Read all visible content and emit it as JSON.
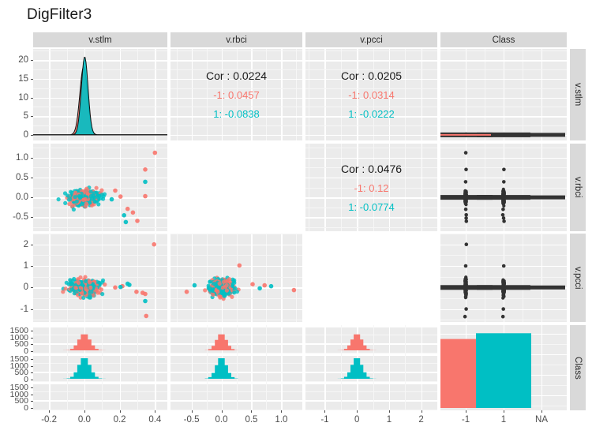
{
  "title": "DigFilter3",
  "colors": {
    "class_neg": "#F8766D",
    "class_pos": "#00BFC4",
    "panel_bg": "#EBEBEB",
    "strip_bg": "#D9D9D9",
    "grid": "#FFFFFF",
    "text": "#4D4D4D"
  },
  "variables": [
    "v.stlm",
    "v.rbci",
    "v.pcci",
    "Class"
  ],
  "column_strips": [
    "v.stlm",
    "v.rbci",
    "v.pcci",
    "Class"
  ],
  "row_strips": [
    "v.stlm",
    "v.rbci",
    "v.pcci",
    "Class"
  ],
  "axes": {
    "x": [
      {
        "var": "v.stlm",
        "ticks": [
          "-0.2",
          "0.0",
          "0.2",
          "0.4"
        ],
        "values": [
          -0.2,
          0.0,
          0.2,
          0.4
        ],
        "range": [
          -0.29,
          0.47
        ]
      },
      {
        "var": "v.rbci",
        "ticks": [
          "-0.5",
          "0.0",
          "0.5",
          "1.0"
        ],
        "values": [
          -0.5,
          0.0,
          0.5,
          1.0
        ],
        "range": [
          -0.85,
          1.35
        ]
      },
      {
        "var": "v.pcci",
        "ticks": [
          "-1",
          "0",
          "1",
          "2"
        ],
        "values": [
          -1,
          0,
          1,
          2
        ],
        "range": [
          -1.6,
          2.5
        ]
      },
      {
        "var": "Class",
        "ticks": [
          "-1",
          "1",
          "NA"
        ],
        "values": [
          "-1",
          "1",
          "NA"
        ],
        "range": null
      }
    ],
    "y": [
      {
        "var": "v.stlm",
        "ticks": [
          "0",
          "5",
          "10",
          "15",
          "20"
        ],
        "values": [
          0,
          5,
          10,
          15,
          20
        ],
        "range": [
          -1.5,
          23
        ]
      },
      {
        "var": "v.rbci",
        "ticks": [
          "-0.5",
          "0.0",
          "0.5",
          "1.0"
        ],
        "values": [
          -0.5,
          0.0,
          0.5,
          1.0
        ],
        "range": [
          -0.85,
          1.35
        ]
      },
      {
        "var": "v.pcci",
        "ticks": [
          "-1",
          "0",
          "1",
          "2"
        ],
        "values": [
          -1,
          0,
          1,
          2
        ],
        "range": [
          -1.6,
          2.5
        ]
      },
      {
        "var": "Class",
        "ticks": [
          "0",
          "500",
          "1000",
          "1500"
        ],
        "values": [
          0,
          500,
          1000,
          1500
        ],
        "range": [
          0,
          1750
        ],
        "facets": [
          "-1",
          "1",
          "NA"
        ]
      }
    ]
  },
  "correlations": [
    {
      "row": "v.stlm",
      "col": "v.rbci",
      "overall_label": "Cor : 0.0224",
      "overall": 0.0224,
      "neg_label": "-1: 0.0457",
      "neg": 0.0457,
      "pos_label": "1: -0.0838",
      "pos": -0.0838
    },
    {
      "row": "v.stlm",
      "col": "v.pcci",
      "overall_label": "Cor : 0.0205",
      "overall": 0.0205,
      "neg_label": "-1: 0.0314",
      "neg": 0.0314,
      "pos_label": "1: -0.0222",
      "pos": -0.0222
    },
    {
      "row": "v.rbci",
      "col": "v.pcci",
      "overall_label": "Cor : 0.0476",
      "overall": 0.0476,
      "neg_label": "-1: 0.12",
      "neg": 0.12,
      "pos_label": "1: -0.0774",
      "pos": -0.0774
    }
  ],
  "class_counts": {
    "categories": [
      "-1",
      "1",
      "NA"
    ],
    "values": [
      1500,
      1625,
      0
    ]
  },
  "chart_data": {
    "type": "scatter",
    "title": "DigFilter3",
    "plot_kind": "pairs-matrix",
    "variables": [
      "v.stlm",
      "v.rbci",
      "v.pcci",
      "Class"
    ],
    "groups": [
      {
        "name": "-1",
        "color": "#F8766D",
        "count": 1500
      },
      {
        "name": "1",
        "color": "#00BFC4",
        "count": 1625
      }
    ],
    "diagonal": [
      {
        "var": "v.stlm",
        "kind": "density",
        "y_max": 21.5,
        "ticks": [
          0,
          5,
          10,
          15,
          20
        ],
        "peak_x": 0.0
      },
      {
        "var": "v.rbci",
        "kind": "density",
        "peak_x": 0.0
      },
      {
        "var": "v.pcci",
        "kind": "density",
        "peak_x": 0.0
      },
      {
        "var": "Class",
        "kind": "bar",
        "categories": [
          "-1",
          "1",
          "NA"
        ],
        "values": [
          1500,
          1625,
          0
        ]
      }
    ],
    "lower_panels": [
      {
        "x": "v.stlm",
        "y": "v.rbci",
        "kind": "scatter"
      },
      {
        "x": "v.stlm",
        "y": "v.pcci",
        "kind": "scatter"
      },
      {
        "x": "v.rbci",
        "y": "v.pcci",
        "kind": "scatter"
      },
      {
        "x": "v.stlm",
        "y": "Class",
        "kind": "histogram-facet"
      },
      {
        "x": "v.rbci",
        "y": "Class",
        "kind": "histogram-facet"
      },
      {
        "x": "v.pcci",
        "y": "Class",
        "kind": "histogram-facet"
      }
    ],
    "upper_panels": [
      {
        "x": "v.rbci",
        "y": "v.stlm",
        "kind": "correlation-text"
      },
      {
        "x": "v.pcci",
        "y": "v.stlm",
        "kind": "correlation-text"
      },
      {
        "x": "v.pcci",
        "y": "v.rbci",
        "kind": "correlation-text"
      },
      {
        "x": "Class",
        "y": "v.stlm",
        "kind": "box-strip"
      },
      {
        "x": "Class",
        "y": "v.rbci",
        "kind": "box-strip"
      },
      {
        "x": "Class",
        "y": "v.pcci",
        "kind": "box-strip"
      }
    ],
    "legend": "none",
    "grid": true
  }
}
